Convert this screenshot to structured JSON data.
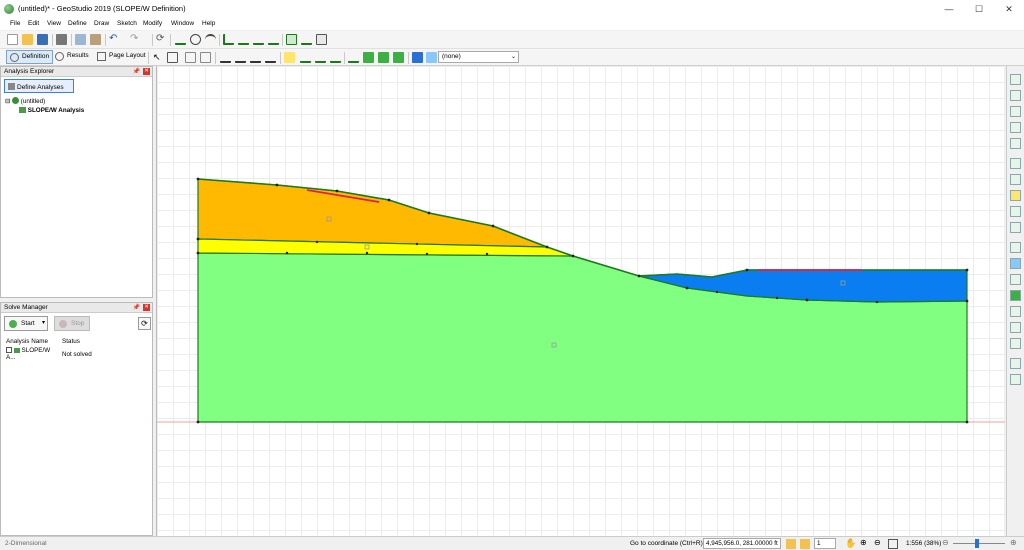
{
  "window": {
    "title": "(untitled)* - GeoStudio 2019 (SLOPE/W Definition)",
    "minimize": "—",
    "maximize": "☐",
    "close": "✕"
  },
  "menu": [
    "File",
    "Edit",
    "View",
    "Define",
    "Draw",
    "Sketch",
    "Modify",
    "Window",
    "Help"
  ],
  "modes": {
    "definition": "Definition",
    "results": "Results",
    "page_layout": "Page Layout"
  },
  "toolbar2": {
    "combo_value": "(none)"
  },
  "analysis_explorer": {
    "title": "Analysis Explorer",
    "define_button": "Define Analyses",
    "tree_root": "(untitled)",
    "tree_child": "SLOPE/W Analysis"
  },
  "solve_manager": {
    "title": "Solve Manager",
    "start": "Start",
    "stop": "Stop",
    "columns": [
      "Analysis Name",
      "Status"
    ],
    "rows": [
      {
        "name": "SLOPE/W A...",
        "status": "Not solved"
      }
    ]
  },
  "status": {
    "mode": "2-Dimensional",
    "goto_label": "Go to coordinate (Ctrl+R):",
    "goto_value": "4,945,956.0, 281.00000 ft",
    "spin_value": "1",
    "zoom_text": "1:556 (38%)"
  },
  "colors": {
    "layer_top": "#ffb900",
    "layer_mid": "#ffff00",
    "layer_base": "#80ff80",
    "water_layer": "#0a7ef0",
    "boundary": "#1e7a1e",
    "slip_marker": "#e0204a"
  }
}
